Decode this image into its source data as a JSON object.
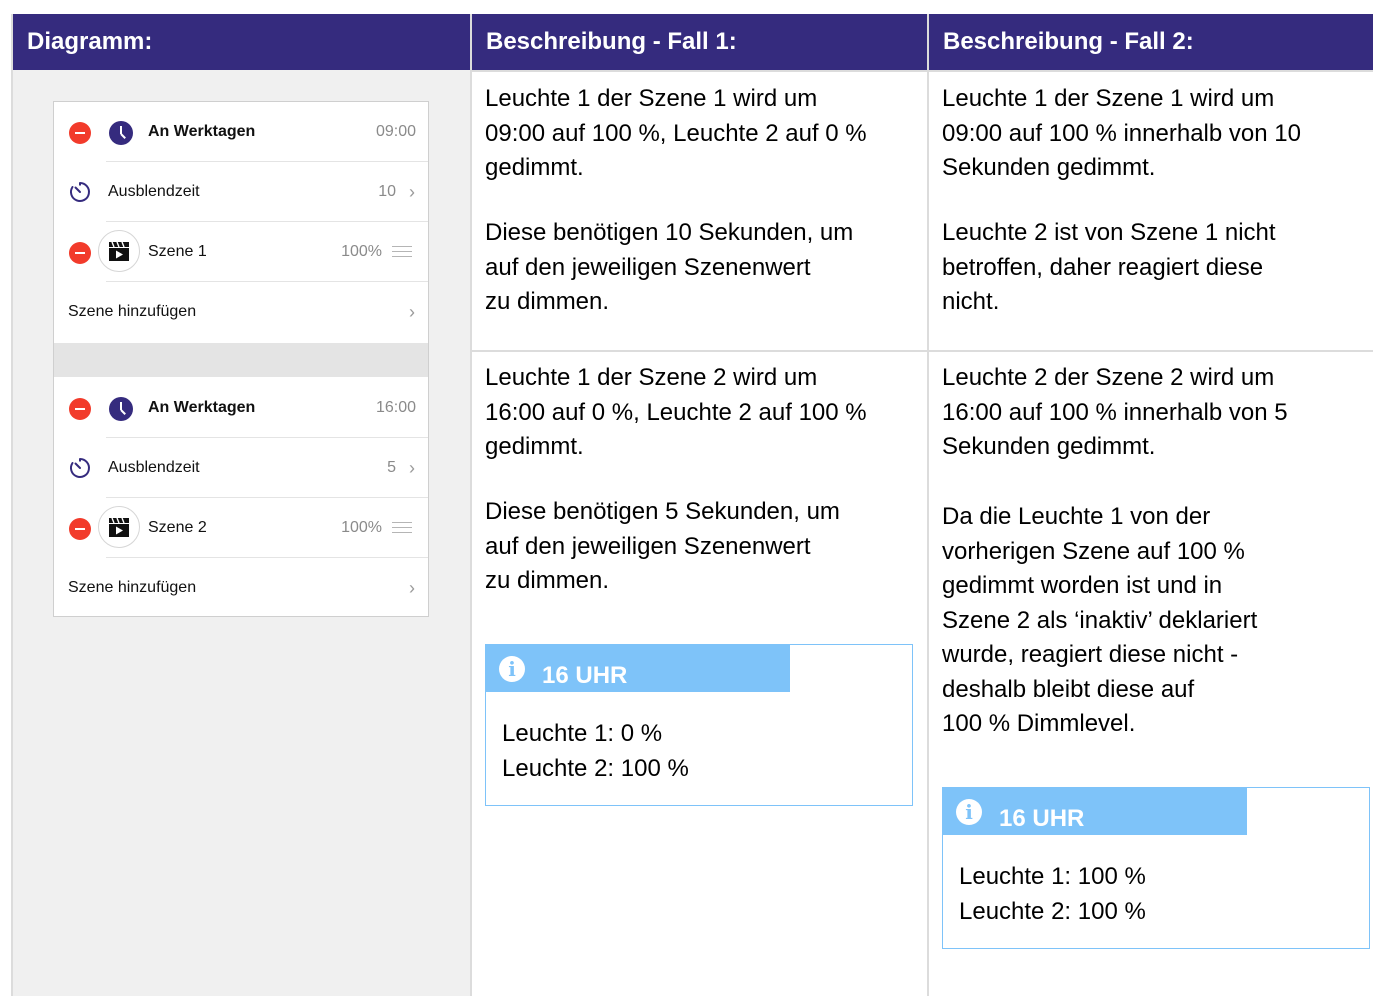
{
  "headers": {
    "diagram": "Diagramm:",
    "case1": "Beschreibung - Fall 1:",
    "case2": "Beschreibung - Fall 2:"
  },
  "diagram": {
    "block1": {
      "schedule_label": "An Werktagen",
      "schedule_time": "09:00",
      "fade_label": "Ausblendzeit",
      "fade_value": "10",
      "scene_label": "Szene 1",
      "scene_value": "100%",
      "add_scene": "Szene hinzufügen"
    },
    "block2": {
      "schedule_label": "An Werktagen",
      "schedule_time": "16:00",
      "fade_label": "Ausblendzeit",
      "fade_value": "5",
      "scene_label": "Szene 2",
      "scene_value": "100%",
      "add_scene": "Szene hinzufügen"
    },
    "chevron": "›"
  },
  "case1": {
    "row1": {
      "p1": [
        "Leuchte 1 der Szene 1 wird um",
        "09:00 auf 100 %, Leuchte 2 auf 0 %",
        "gedimmt."
      ],
      "p2": [
        "Diese benötigen 10 Sekunden, um",
        "auf den jeweiligen Szenenwert",
        "zu dimmen."
      ]
    },
    "row2": {
      "p1": [
        "Leuchte 1 der Szene 2 wird um",
        "16:00 auf 0 %, Leuchte 2 auf 100 %",
        "gedimmt."
      ],
      "p2": [
        "Diese benötigen 5 Sekunden, um",
        "auf den jeweiligen Szenenwert",
        "zu dimmen."
      ],
      "info": {
        "title": "16 UHR",
        "lines": [
          "Leuchte 1: 0 %",
          "Leuchte 2: 100 %"
        ]
      }
    }
  },
  "case2": {
    "row1": {
      "p1": [
        "Leuchte 1 der Szene 1 wird um",
        "09:00 auf 100 % innerhalb von 10",
        "Sekunden gedimmt."
      ],
      "p2": [
        "Leuchte 2 ist von Szene 1 nicht",
        "betroffen, daher reagiert diese",
        "nicht."
      ]
    },
    "row2": {
      "p1": [
        "Leuchte 2 der Szene 2 wird um",
        "16:00 auf 100 % innerhalb von 5",
        "Sekunden gedimmt."
      ],
      "p2": [
        "Da die Leuchte 1 von der",
        "vorherigen Szene auf 100 %",
        "gedimmt worden ist und in",
        "Szene 2 als ‘inaktiv’ deklariert",
        "wurde, reagiert diese nicht -",
        "deshalb bleibt diese auf",
        "100 % Dimmlevel."
      ],
      "info": {
        "title": "16 UHR",
        "lines": [
          "Leuchte 1: 100 %",
          "Leuchte 2: 100 %"
        ]
      }
    }
  },
  "colors": {
    "header_bg": "#352b7e",
    "accent_red": "#f23b2b",
    "info_blue": "#7ec3f9"
  }
}
